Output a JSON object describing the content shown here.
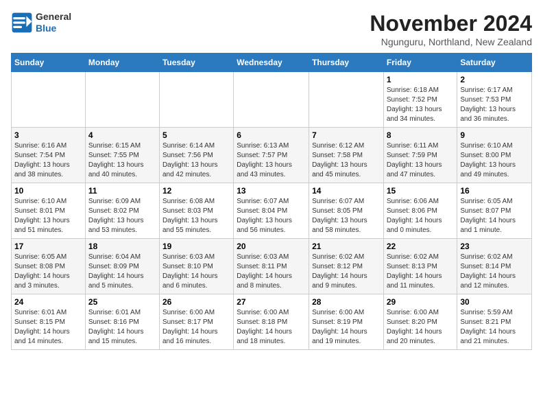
{
  "header": {
    "logo": {
      "general": "General",
      "blue": "Blue"
    },
    "title": "November 2024",
    "location": "Ngunguru, Northland, New Zealand"
  },
  "weekdays": [
    "Sunday",
    "Monday",
    "Tuesday",
    "Wednesday",
    "Thursday",
    "Friday",
    "Saturday"
  ],
  "weeks": [
    [
      {
        "day": "",
        "info": ""
      },
      {
        "day": "",
        "info": ""
      },
      {
        "day": "",
        "info": ""
      },
      {
        "day": "",
        "info": ""
      },
      {
        "day": "",
        "info": ""
      },
      {
        "day": "1",
        "info": "Sunrise: 6:18 AM\nSunset: 7:52 PM\nDaylight: 13 hours\nand 34 minutes."
      },
      {
        "day": "2",
        "info": "Sunrise: 6:17 AM\nSunset: 7:53 PM\nDaylight: 13 hours\nand 36 minutes."
      }
    ],
    [
      {
        "day": "3",
        "info": "Sunrise: 6:16 AM\nSunset: 7:54 PM\nDaylight: 13 hours\nand 38 minutes."
      },
      {
        "day": "4",
        "info": "Sunrise: 6:15 AM\nSunset: 7:55 PM\nDaylight: 13 hours\nand 40 minutes."
      },
      {
        "day": "5",
        "info": "Sunrise: 6:14 AM\nSunset: 7:56 PM\nDaylight: 13 hours\nand 42 minutes."
      },
      {
        "day": "6",
        "info": "Sunrise: 6:13 AM\nSunset: 7:57 PM\nDaylight: 13 hours\nand 43 minutes."
      },
      {
        "day": "7",
        "info": "Sunrise: 6:12 AM\nSunset: 7:58 PM\nDaylight: 13 hours\nand 45 minutes."
      },
      {
        "day": "8",
        "info": "Sunrise: 6:11 AM\nSunset: 7:59 PM\nDaylight: 13 hours\nand 47 minutes."
      },
      {
        "day": "9",
        "info": "Sunrise: 6:10 AM\nSunset: 8:00 PM\nDaylight: 13 hours\nand 49 minutes."
      }
    ],
    [
      {
        "day": "10",
        "info": "Sunrise: 6:10 AM\nSunset: 8:01 PM\nDaylight: 13 hours\nand 51 minutes."
      },
      {
        "day": "11",
        "info": "Sunrise: 6:09 AM\nSunset: 8:02 PM\nDaylight: 13 hours\nand 53 minutes."
      },
      {
        "day": "12",
        "info": "Sunrise: 6:08 AM\nSunset: 8:03 PM\nDaylight: 13 hours\nand 55 minutes."
      },
      {
        "day": "13",
        "info": "Sunrise: 6:07 AM\nSunset: 8:04 PM\nDaylight: 13 hours\nand 56 minutes."
      },
      {
        "day": "14",
        "info": "Sunrise: 6:07 AM\nSunset: 8:05 PM\nDaylight: 13 hours\nand 58 minutes."
      },
      {
        "day": "15",
        "info": "Sunrise: 6:06 AM\nSunset: 8:06 PM\nDaylight: 14 hours\nand 0 minutes."
      },
      {
        "day": "16",
        "info": "Sunrise: 6:05 AM\nSunset: 8:07 PM\nDaylight: 14 hours\nand 1 minute."
      }
    ],
    [
      {
        "day": "17",
        "info": "Sunrise: 6:05 AM\nSunset: 8:08 PM\nDaylight: 14 hours\nand 3 minutes."
      },
      {
        "day": "18",
        "info": "Sunrise: 6:04 AM\nSunset: 8:09 PM\nDaylight: 14 hours\nand 5 minutes."
      },
      {
        "day": "19",
        "info": "Sunrise: 6:03 AM\nSunset: 8:10 PM\nDaylight: 14 hours\nand 6 minutes."
      },
      {
        "day": "20",
        "info": "Sunrise: 6:03 AM\nSunset: 8:11 PM\nDaylight: 14 hours\nand 8 minutes."
      },
      {
        "day": "21",
        "info": "Sunrise: 6:02 AM\nSunset: 8:12 PM\nDaylight: 14 hours\nand 9 minutes."
      },
      {
        "day": "22",
        "info": "Sunrise: 6:02 AM\nSunset: 8:13 PM\nDaylight: 14 hours\nand 11 minutes."
      },
      {
        "day": "23",
        "info": "Sunrise: 6:02 AM\nSunset: 8:14 PM\nDaylight: 14 hours\nand 12 minutes."
      }
    ],
    [
      {
        "day": "24",
        "info": "Sunrise: 6:01 AM\nSunset: 8:15 PM\nDaylight: 14 hours\nand 14 minutes."
      },
      {
        "day": "25",
        "info": "Sunrise: 6:01 AM\nSunset: 8:16 PM\nDaylight: 14 hours\nand 15 minutes."
      },
      {
        "day": "26",
        "info": "Sunrise: 6:00 AM\nSunset: 8:17 PM\nDaylight: 14 hours\nand 16 minutes."
      },
      {
        "day": "27",
        "info": "Sunrise: 6:00 AM\nSunset: 8:18 PM\nDaylight: 14 hours\nand 18 minutes."
      },
      {
        "day": "28",
        "info": "Sunrise: 6:00 AM\nSunset: 8:19 PM\nDaylight: 14 hours\nand 19 minutes."
      },
      {
        "day": "29",
        "info": "Sunrise: 6:00 AM\nSunset: 8:20 PM\nDaylight: 14 hours\nand 20 minutes."
      },
      {
        "day": "30",
        "info": "Sunrise: 5:59 AM\nSunset: 8:21 PM\nDaylight: 14 hours\nand 21 minutes."
      }
    ]
  ]
}
